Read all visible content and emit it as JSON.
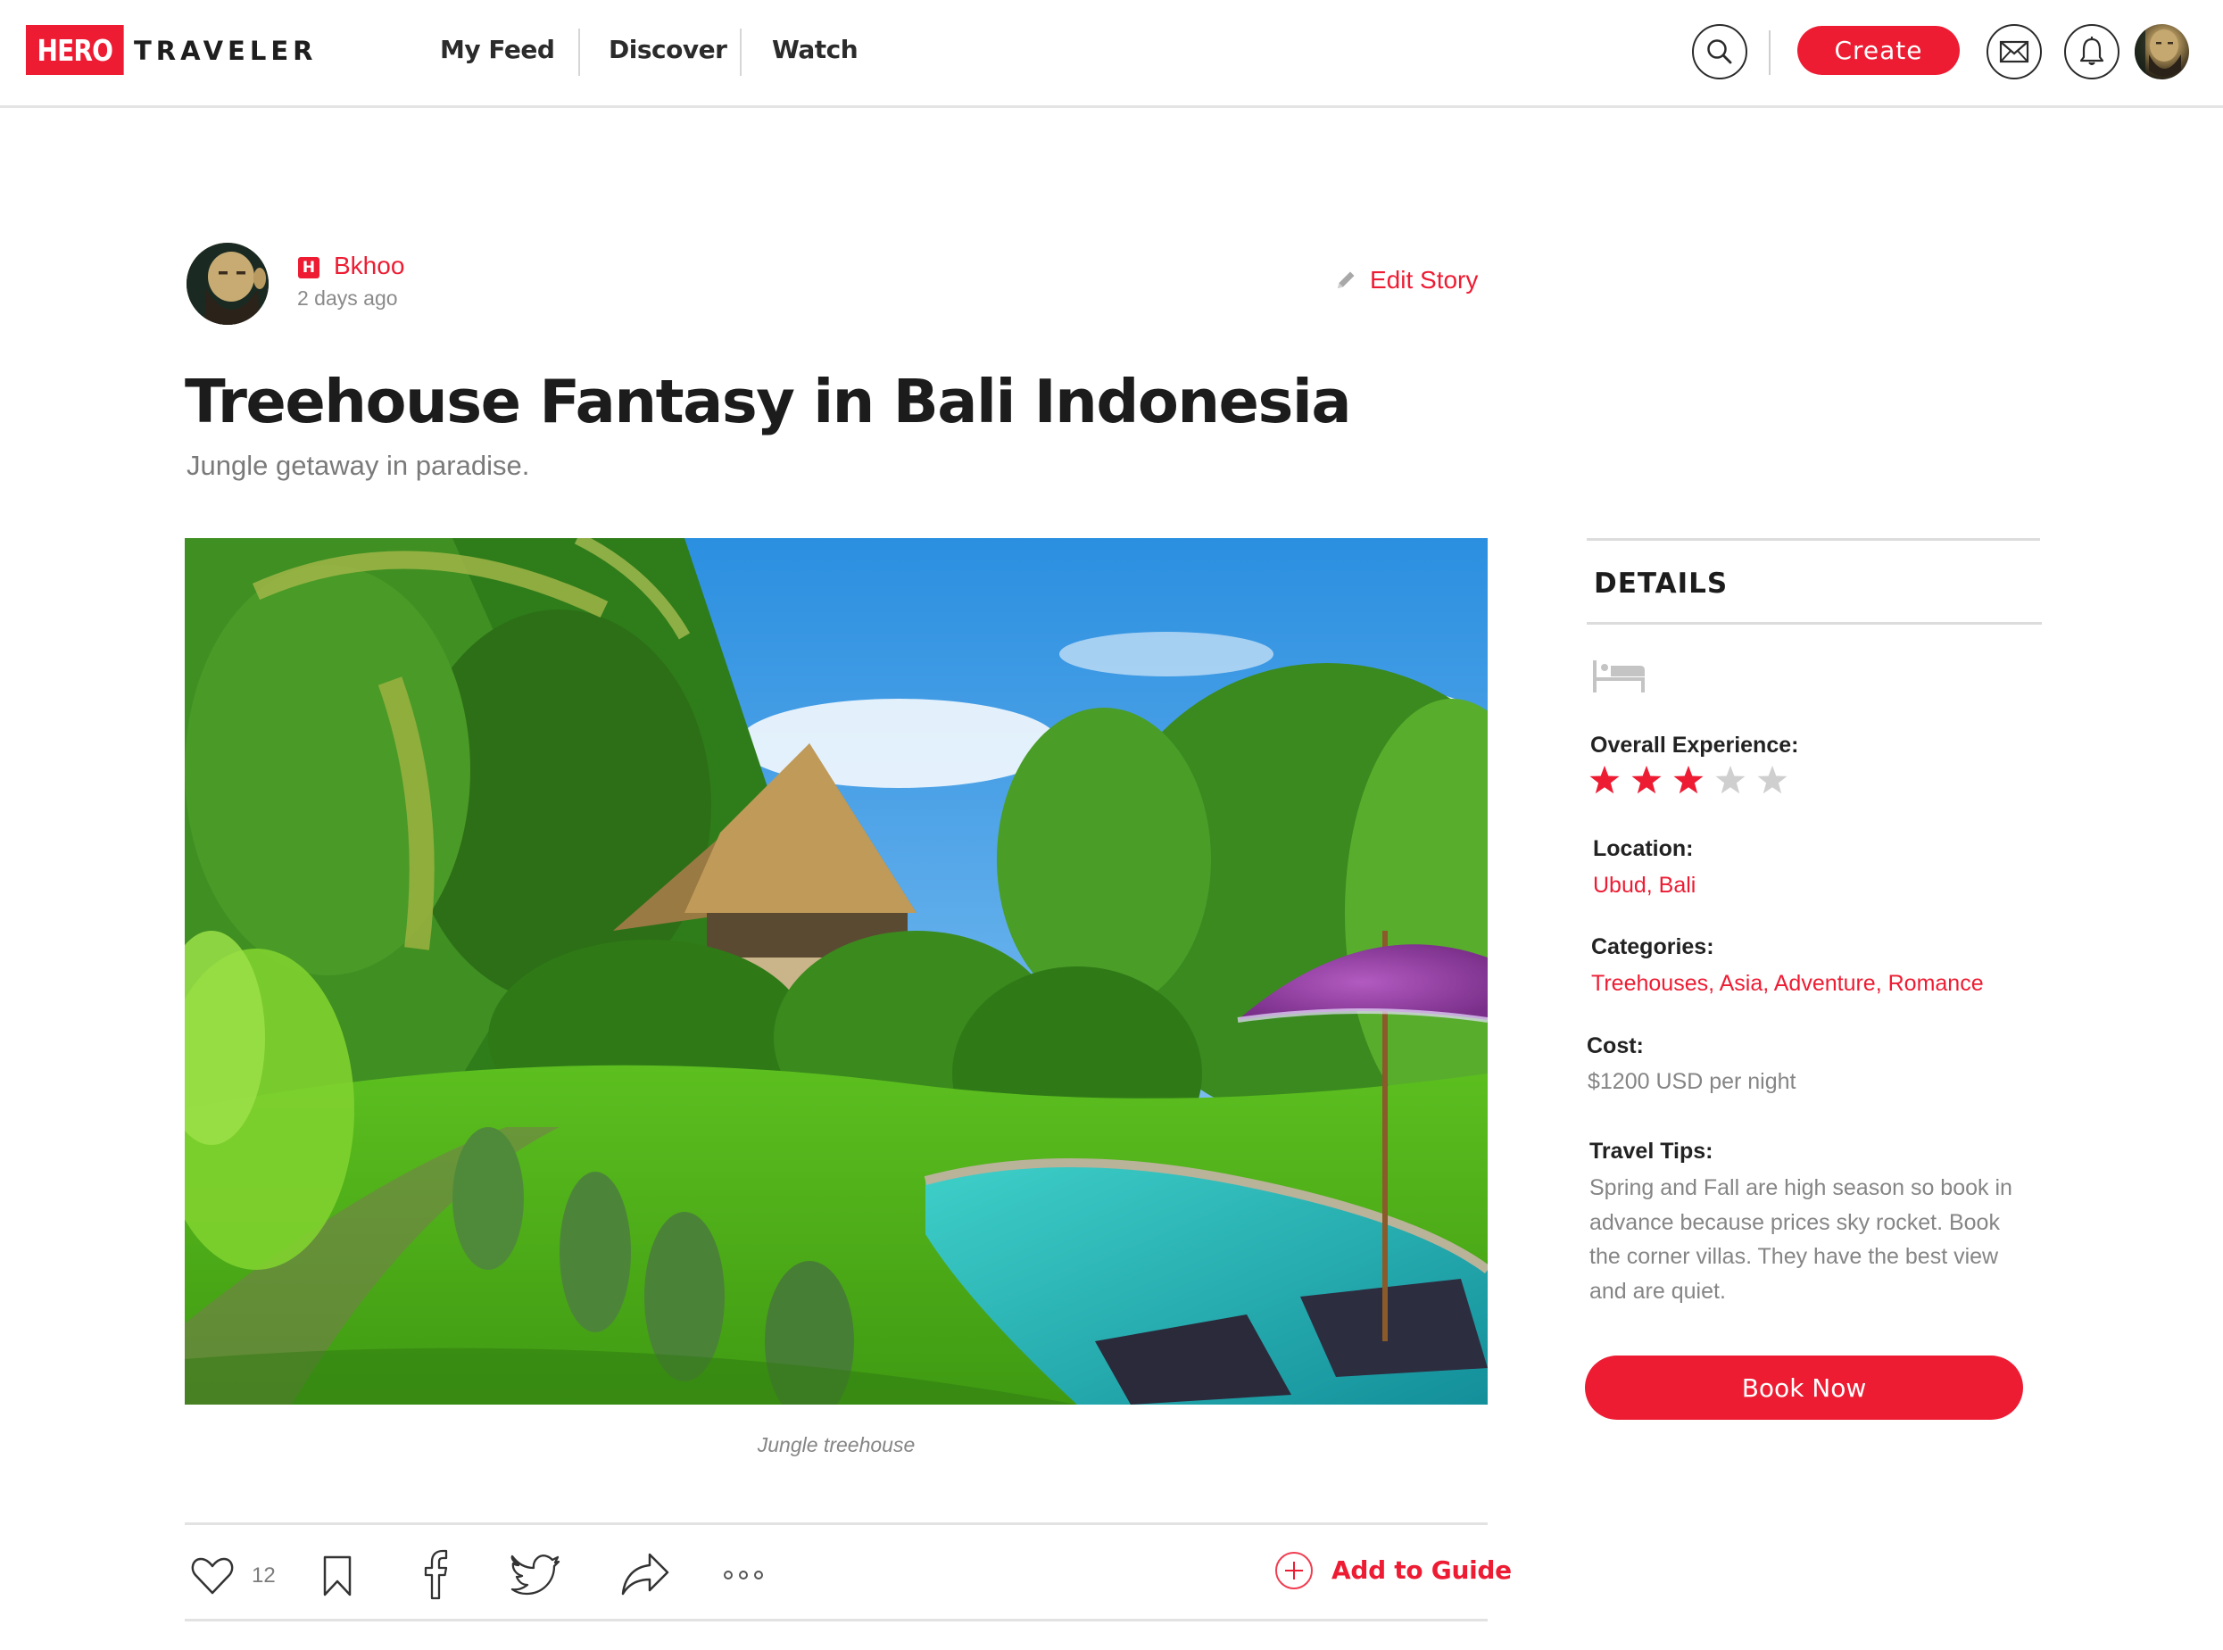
{
  "header": {
    "logo_badge": "HERO",
    "logo_text": "TRAVELER",
    "nav": [
      {
        "label": "My Feed"
      },
      {
        "label": "Discover"
      },
      {
        "label": "Watch"
      }
    ],
    "create_label": "Create",
    "icons": [
      "search-icon",
      "mail-icon",
      "bell-icon",
      "user-avatar"
    ]
  },
  "story": {
    "author": {
      "badge": "H",
      "name": "Bkhoo",
      "time": "2 days ago"
    },
    "edit_label": "Edit Story",
    "title": "Treehouse Fantasy in Bali Indonesia",
    "subtitle": "Jungle getaway in paradise.",
    "image_caption": "Jungle treehouse",
    "actions": {
      "like_count": "12",
      "icons": [
        "heart-icon",
        "bookmark-icon",
        "facebook-icon",
        "twitter-icon",
        "share-icon",
        "more-icon"
      ],
      "add_to_guide_label": "Add to Guide"
    }
  },
  "details": {
    "heading": "DETAILS",
    "type_icon": "bed-icon",
    "overall_experience": {
      "label": "Overall Experience:",
      "rating": 3,
      "max_rating": 5
    },
    "location": {
      "label": "Location:",
      "value": "Ubud, Bali"
    },
    "categories": {
      "label": "Categories:",
      "value": "Treehouses, Asia, Adventure, Romance"
    },
    "cost": {
      "label": "Cost:",
      "value": "$1200 USD per night"
    },
    "travel_tips": {
      "label": "Travel Tips:",
      "value": "Spring and Fall are high season so book in advance because prices sky rocket. Book the corner villas. They have the best view and are quiet."
    },
    "book_label": "Book Now"
  },
  "colors": {
    "accent": "#ED1C33",
    "star_filled": "#ED1C33",
    "star_empty": "#cfcfcf",
    "text_muted": "#858585"
  }
}
